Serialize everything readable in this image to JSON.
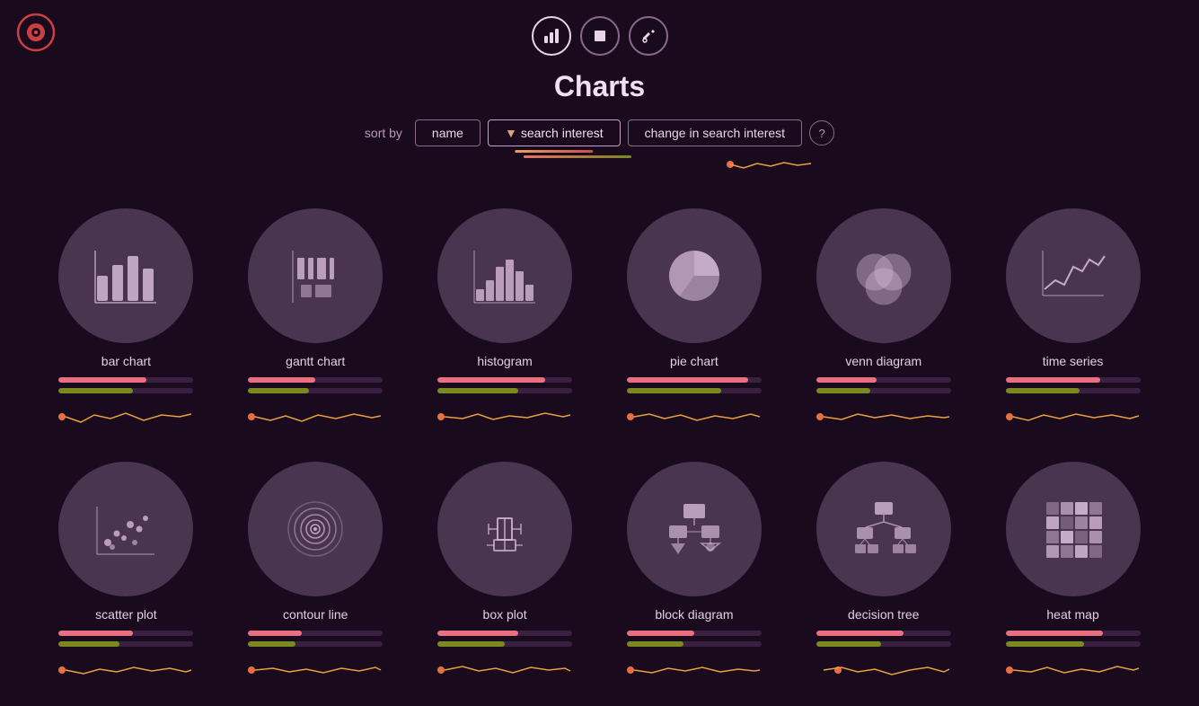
{
  "app": {
    "title": "Charts",
    "logo_alt": "logo"
  },
  "nav": {
    "buttons": [
      {
        "id": "chart-icon",
        "label": "📊",
        "active": true
      },
      {
        "id": "stop-icon",
        "label": "⬛",
        "active": false
      },
      {
        "id": "tools-icon",
        "label": "🔧",
        "active": false
      }
    ]
  },
  "sort_bar": {
    "label": "sort by",
    "buttons": [
      {
        "id": "name",
        "label": "name",
        "active": false
      },
      {
        "id": "search-interest",
        "label": "search interest",
        "active": true,
        "arrow": "▼"
      },
      {
        "id": "change-search-interest",
        "label": "change in search interest",
        "active": false
      }
    ],
    "help_label": "?"
  },
  "charts_row1": [
    {
      "id": "bar-chart",
      "name": "bar chart",
      "bar_pink": 65,
      "bar_green": 55
    },
    {
      "id": "gantt-chart",
      "name": "gantt chart",
      "bar_pink": 50,
      "bar_green": 45
    },
    {
      "id": "histogram",
      "name": "histogram",
      "bar_pink": 80,
      "bar_green": 60
    },
    {
      "id": "pie-chart",
      "name": "pie chart",
      "bar_pink": 90,
      "bar_green": 70
    },
    {
      "id": "venn-diagram",
      "name": "venn diagram",
      "bar_pink": 45,
      "bar_green": 40
    },
    {
      "id": "time-series",
      "name": "time series",
      "bar_pink": 70,
      "bar_green": 55
    }
  ],
  "charts_row2": [
    {
      "id": "scatter-plot",
      "name": "scatter plot",
      "bar_pink": 55,
      "bar_green": 45
    },
    {
      "id": "contour-line",
      "name": "contour line",
      "bar_pink": 40,
      "bar_green": 35
    },
    {
      "id": "box-plot",
      "name": "box plot",
      "bar_pink": 60,
      "bar_green": 50
    },
    {
      "id": "block-diagram",
      "name": "block diagram",
      "bar_pink": 50,
      "bar_green": 42
    },
    {
      "id": "decision-tree",
      "name": "decision tree",
      "bar_pink": 65,
      "bar_green": 48
    },
    {
      "id": "heat-map",
      "name": "heat map",
      "bar_pink": 72,
      "bar_green": 58
    }
  ],
  "colors": {
    "bg": "#1a0a1e",
    "circle": "#4a3550",
    "pink_bar": "#e87080",
    "green_bar": "#7a8a20",
    "sparkline": "#e8a040",
    "dot": "#e87040"
  }
}
